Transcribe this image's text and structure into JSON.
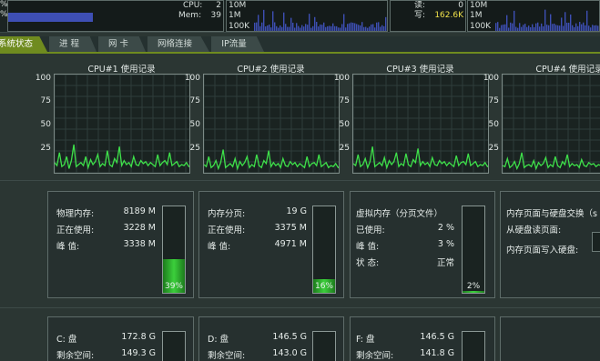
{
  "top": {
    "left_prefix_1": "%",
    "left_prefix_2": "%",
    "cpu_label": "CPU:",
    "cpu_value": "2",
    "mem_label": "Mem:",
    "mem_value": "39",
    "cpu_bar_fraction": 0.02,
    "mem_bar_fraction": 0.39,
    "net_scale": [
      "10M",
      "1M",
      "100K"
    ],
    "read_label": "读:",
    "read_value": "0",
    "write_label": "写:",
    "write_value": "162.6K",
    "disk_scale": [
      "10M",
      "1M",
      "100K"
    ],
    "right_scale": [
      "10M",
      "1M",
      "100K"
    ]
  },
  "tabs": [
    {
      "label": "系统状态",
      "active": true
    },
    {
      "label": "进 程",
      "active": false
    },
    {
      "label": "网 卡",
      "active": false
    },
    {
      "label": "网络连接",
      "active": false
    },
    {
      "label": "IP流量",
      "active": false
    }
  ],
  "cpu_axis": [
    "100",
    "75",
    "50",
    "25"
  ],
  "cpus": [
    {
      "title": "CPU#1 使用记录",
      "history": [
        12,
        9,
        22,
        8,
        10,
        18,
        6,
        14,
        30,
        8,
        10,
        12,
        9,
        18,
        7,
        15,
        10,
        13,
        20,
        8,
        11,
        9,
        24,
        10,
        8,
        16,
        12,
        28,
        9,
        14,
        10,
        12,
        8,
        18,
        10,
        9,
        14,
        11,
        13,
        9,
        12,
        10,
        8,
        20,
        9,
        12,
        14,
        10,
        22,
        9,
        11,
        13,
        8,
        10,
        9,
        12,
        8,
        10
      ]
    },
    {
      "title": "CPU#2 使用记录",
      "history": [
        10,
        8,
        18,
        7,
        9,
        14,
        6,
        12,
        25,
        7,
        9,
        11,
        8,
        16,
        6,
        13,
        9,
        12,
        18,
        7,
        10,
        8,
        20,
        9,
        7,
        14,
        11,
        24,
        8,
        12,
        9,
        11,
        7,
        16,
        9,
        8,
        13,
        10,
        12,
        8,
        11,
        9,
        7,
        18,
        8,
        11,
        12,
        9,
        20,
        8,
        10,
        12,
        7,
        9,
        8,
        11,
        7,
        9
      ]
    },
    {
      "title": "CPU#3 使用记录",
      "history": [
        11,
        9,
        20,
        8,
        10,
        16,
        7,
        13,
        28,
        8,
        10,
        12,
        9,
        17,
        7,
        14,
        10,
        13,
        22,
        8,
        11,
        9,
        21,
        10,
        8,
        15,
        12,
        26,
        9,
        13,
        10,
        12,
        8,
        17,
        10,
        9,
        14,
        11,
        13,
        9,
        12,
        10,
        8,
        19,
        9,
        12,
        13,
        10,
        21,
        9,
        11,
        13,
        8,
        10,
        9,
        12,
        8,
        10
      ]
    },
    {
      "title": "CPU#4 使用记录",
      "history": [
        9,
        8,
        16,
        7,
        9,
        13,
        6,
        11,
        22,
        7,
        9,
        10,
        8,
        14,
        6,
        12,
        9,
        11,
        17,
        7,
        10,
        8,
        18,
        9,
        7,
        13,
        10,
        20,
        8,
        11,
        9,
        10,
        7,
        15,
        9,
        8,
        12,
        10,
        11,
        8,
        10,
        9,
        7,
        16,
        8,
        10,
        11,
        9,
        18,
        8,
        10,
        11,
        7,
        9,
        8,
        10,
        7,
        9
      ]
    }
  ],
  "memory": {
    "physical": {
      "rows": [
        {
          "label": "物理内存:",
          "value": "8189 M"
        },
        {
          "label": "正在使用:",
          "value": "3228 M"
        },
        {
          "label": "峰    值:",
          "value": "3338 M"
        }
      ],
      "percent_text": "39%",
      "percent": 39
    },
    "paged": {
      "rows": [
        {
          "label": "内存分页:",
          "value": "19 G"
        },
        {
          "label": "正在使用:",
          "value": "3375 M"
        },
        {
          "label": "峰    值:",
          "value": "4971 M"
        }
      ],
      "percent_text": "16%",
      "percent": 16
    },
    "virtual": {
      "rows": [
        {
          "label": "虚拟内存（分页文件）",
          "value": ""
        },
        {
          "label": "已使用:",
          "value": "2 %"
        },
        {
          "label": "峰    值:",
          "value": "3 %"
        },
        {
          "label": "状    态:",
          "value": "正常"
        }
      ],
      "percent_text": "2%",
      "percent": 2
    },
    "swap": {
      "rows": [
        {
          "label": "内存页面与硬盘交换（s"
        },
        {
          "label": "从硬盘读页面:"
        },
        {
          "label": "内存页面写入硬盘:"
        }
      ]
    }
  },
  "disks": [
    {
      "name": "C: 盘",
      "total": "172.8 G",
      "free_label": "剩余空间:",
      "free": "149.3 G"
    },
    {
      "name": "D: 盘",
      "total": "146.5 G",
      "free_label": "剩余空间:",
      "free": "143.0 G"
    },
    {
      "name": "F: 盘",
      "total": "146.5 G",
      "free_label": "剩余空间:",
      "free": "141.8 G"
    }
  ],
  "colors": {
    "graph_line": "#3ee04a",
    "graph_grid": "#2f3d3a",
    "accent_tab": "#6f8b1f",
    "mini_graph": "#3e4fb4",
    "write_value": "#f0e24a"
  }
}
